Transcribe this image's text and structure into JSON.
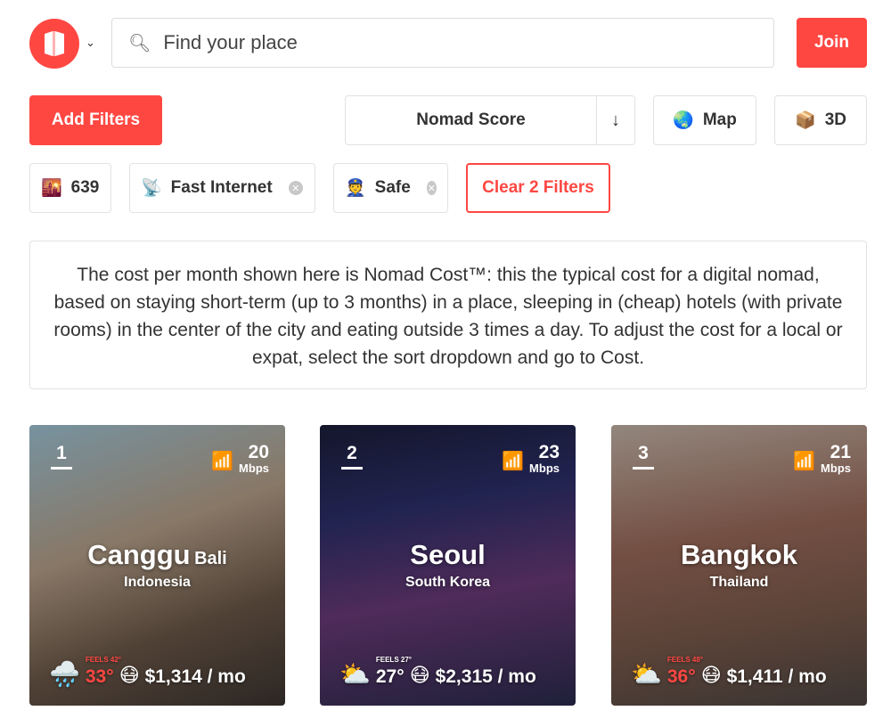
{
  "header": {
    "search_placeholder": "Find your place",
    "join_label": "Join"
  },
  "controls": {
    "add_filters_label": "Add Filters",
    "sort_label": "Nomad Score",
    "sort_direction": "↓",
    "map_label": "Map",
    "threed_label": "3D"
  },
  "filters": {
    "count_value": "639",
    "chips": [
      {
        "label": "Fast Internet",
        "icon": "satellite-dish-icon"
      },
      {
        "label": "Safe",
        "icon": "police-officer-icon"
      }
    ],
    "clear_label": "Clear 2 Filters"
  },
  "notice": {
    "text": "The cost per month shown here is Nomad Cost™: this the typical cost for a digital nomad, based on staying short-term (up to 3 months) in a place, sleeping in (cheap) hotels (with private rooms) in the center of the city and eating outside 3 times a day. To adjust the cost for a local or expat, select the sort dropdown and go to Cost."
  },
  "cards": [
    {
      "rank": "1",
      "internet": "20",
      "internet_unit": "Mbps",
      "city": "Canggu",
      "region": "Bali",
      "country": "Indonesia",
      "weather_icon": "rain-cloud-icon",
      "feels": "FEELS 42°",
      "temp": "33°",
      "cost": "$1,314 / mo"
    },
    {
      "rank": "2",
      "internet": "23",
      "internet_unit": "Mbps",
      "city": "Seoul",
      "region": "",
      "country": "South Korea",
      "weather_icon": "sun-behind-cloud-icon",
      "feels": "FEELS 27°",
      "temp": "27°",
      "cost": "$2,315 / mo"
    },
    {
      "rank": "3",
      "internet": "21",
      "internet_unit": "Mbps",
      "city": "Bangkok",
      "region": "",
      "country": "Thailand",
      "weather_icon": "sun-behind-cloud-icon",
      "feels": "FEELS 48°",
      "temp": "36°",
      "cost": "$1,411 / mo"
    }
  ],
  "colors": {
    "accent": "#ff4742",
    "border": "#e2e2e2"
  }
}
